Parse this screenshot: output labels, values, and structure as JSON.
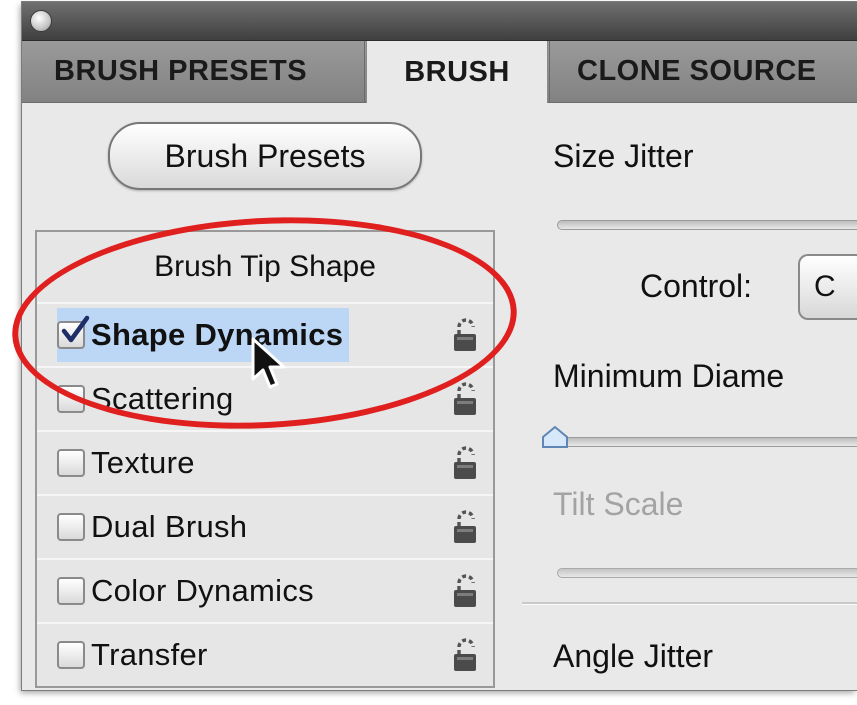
{
  "tabs": [
    {
      "label": "BRUSH PRESETS",
      "active": false
    },
    {
      "label": "BRUSH",
      "active": true
    },
    {
      "label": "CLONE SOURCE",
      "active": false
    }
  ],
  "presets_button": "Brush Presets",
  "brush_tip_shape": "Brush Tip Shape",
  "list_items": [
    {
      "label": "Shape Dynamics",
      "checked": true,
      "selected": true
    },
    {
      "label": "Scattering",
      "checked": false
    },
    {
      "label": "Texture",
      "checked": false
    },
    {
      "label": "Dual Brush",
      "checked": false
    },
    {
      "label": "Color Dynamics",
      "checked": false
    },
    {
      "label": "Transfer",
      "checked": false
    }
  ],
  "right_panel": {
    "size_jitter": "Size Jitter",
    "control_label": "Control:",
    "control_value": "C",
    "minimum_diameter": "Minimum Diame",
    "tilt_scale": "Tilt Scale",
    "angle_jitter": "Angle Jitter"
  },
  "colors": {
    "highlight": "#e01f1f",
    "selection": "#bcd6f6"
  },
  "icons": [
    "lock-icon",
    "checkmark-icon",
    "mouse-cursor-icon",
    "window-close-icon",
    "slider-thumb-icon"
  ]
}
